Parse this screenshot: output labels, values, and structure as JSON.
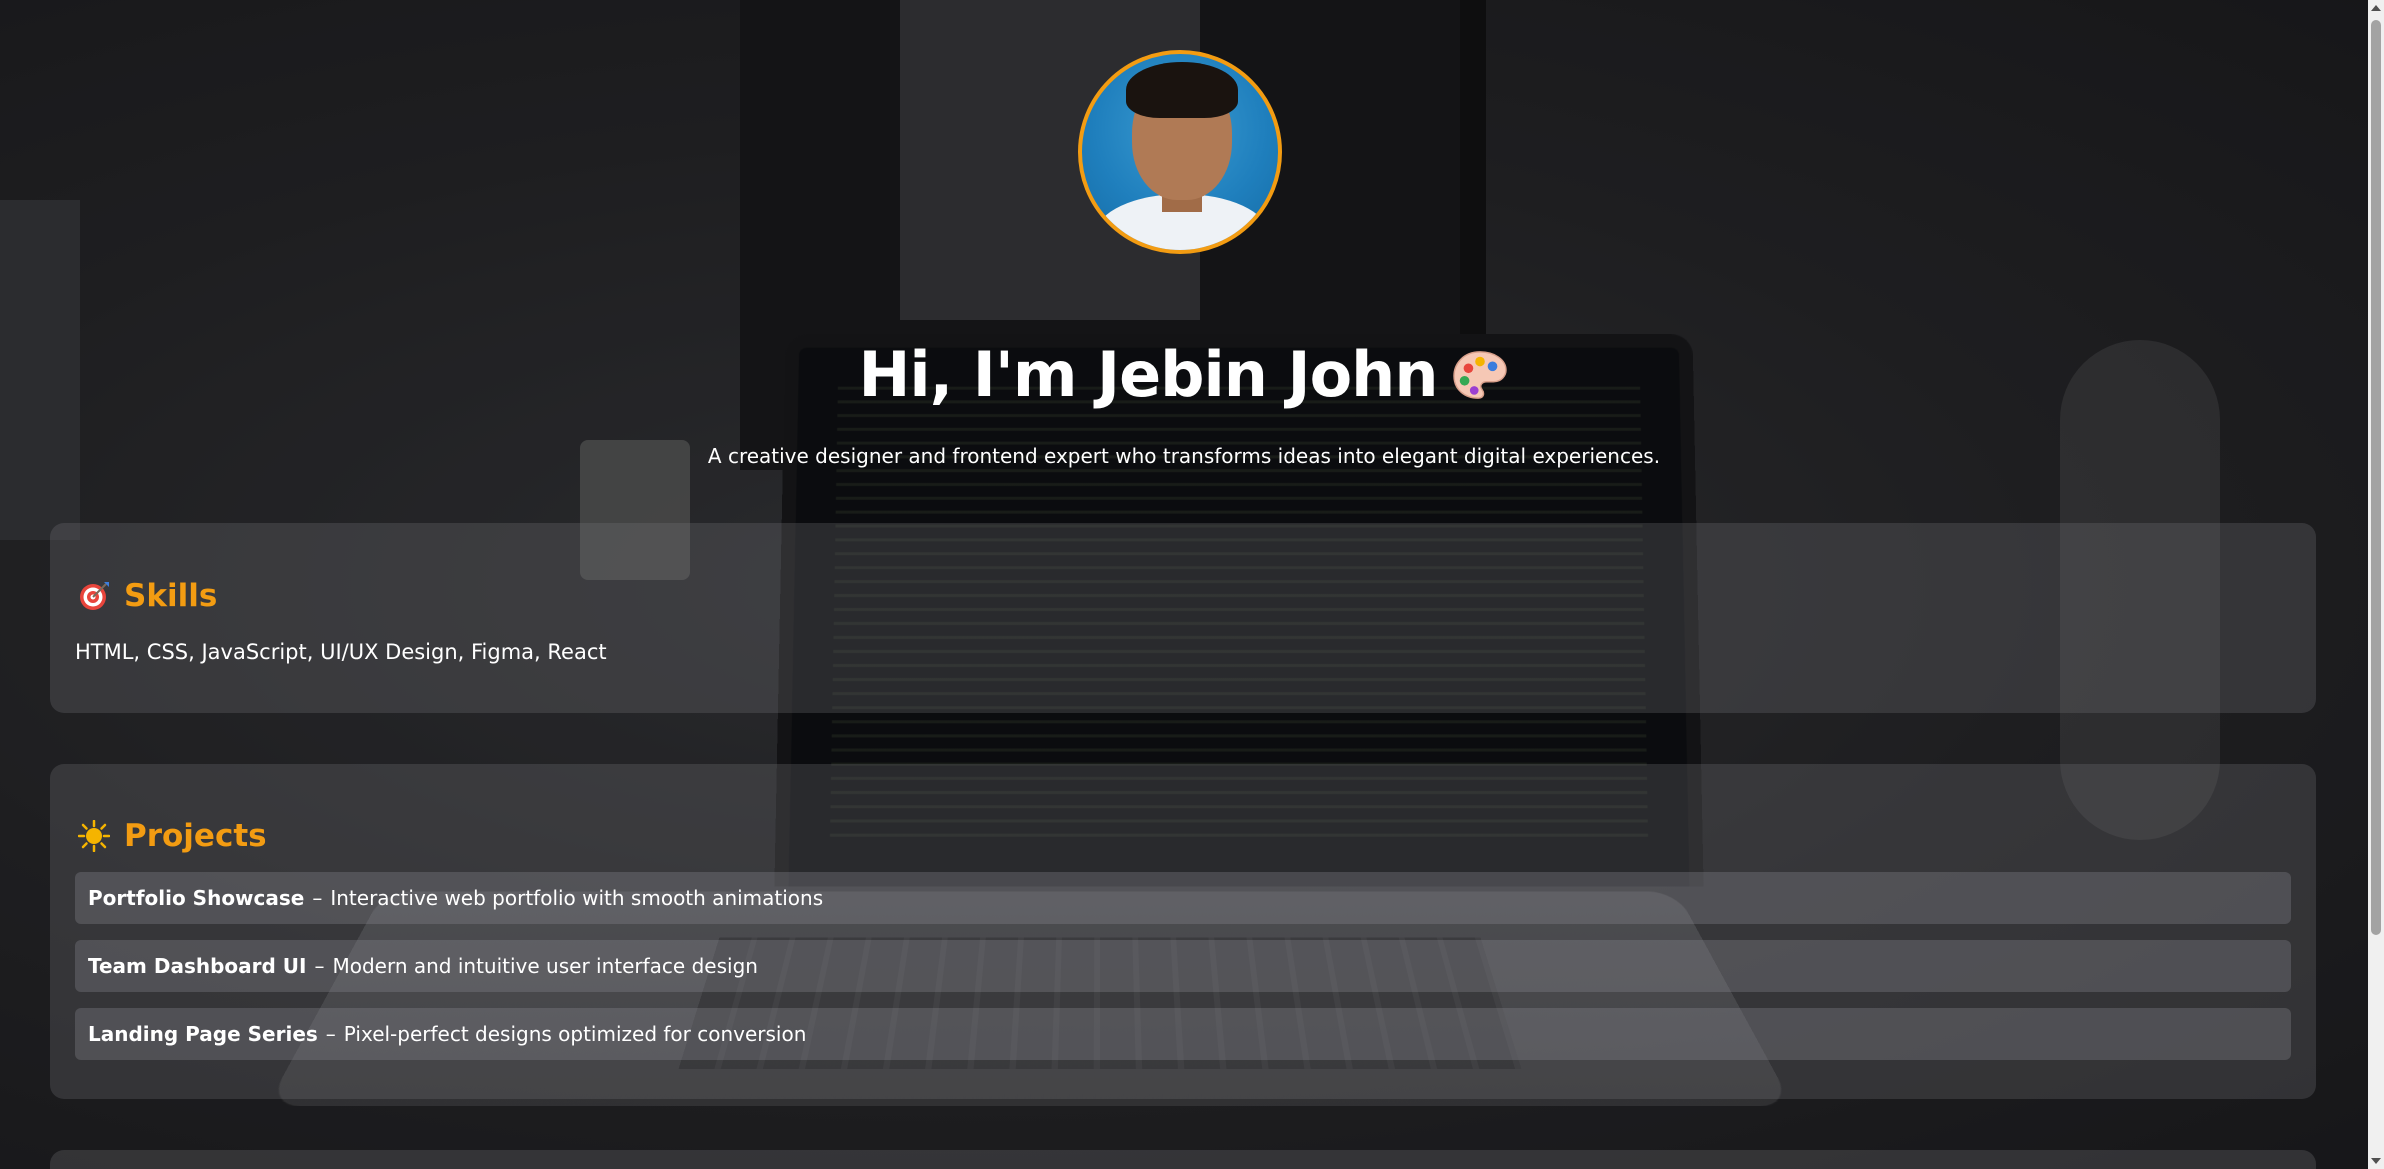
{
  "header": {
    "title": "Hi, I'm Jebin John",
    "title_icon": "artist-palette-icon",
    "subtitle": "A creative designer and frontend expert who transforms ideas into elegant digital experiences."
  },
  "skills": {
    "heading": "Skills",
    "icon": "direct-hit-target-icon",
    "text": "HTML, CSS, JavaScript, UI/UX Design, Figma, React"
  },
  "projects": {
    "heading": "Projects",
    "icon": "sun-icon",
    "items": [
      {
        "name": "Portfolio Showcase",
        "separator": "–",
        "description": "Interactive web portfolio with smooth animations"
      },
      {
        "name": "Team Dashboard UI",
        "separator": "–",
        "description": "Modern and intuitive user interface design"
      },
      {
        "name": "Landing Page Series",
        "separator": "–",
        "description": "Pixel-perfect designs optimized for conversion"
      }
    ]
  },
  "colors": {
    "accent": "#f39c12",
    "text": "#ffffff"
  }
}
